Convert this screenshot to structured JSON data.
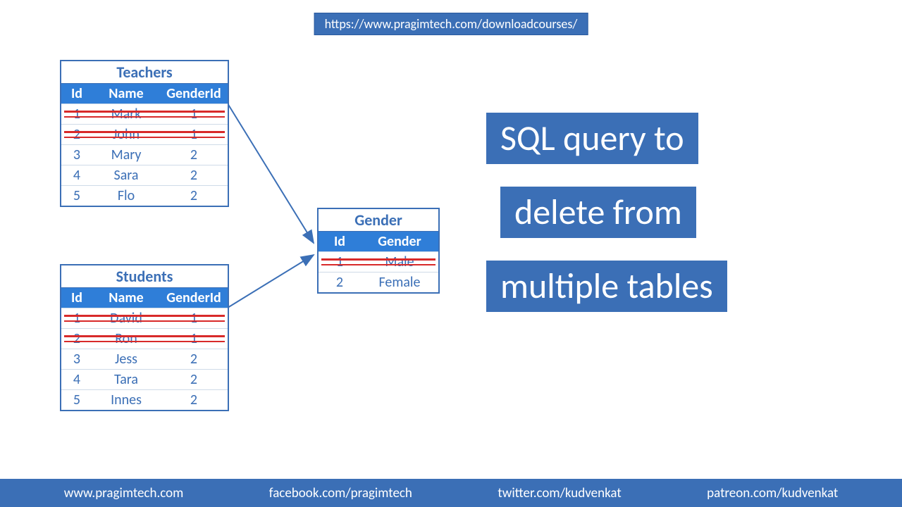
{
  "top_url": "https://www.pragimtech.com/downloadcourses/",
  "tables": {
    "teachers": {
      "title": "Teachers",
      "cols": [
        "Id",
        "Name",
        "GenderId"
      ],
      "rows": [
        {
          "c": [
            "1",
            "Mark",
            "1"
          ],
          "deleted": true
        },
        {
          "c": [
            "2",
            "John",
            "1"
          ],
          "deleted": true
        },
        {
          "c": [
            "3",
            "Mary",
            "2"
          ],
          "deleted": false
        },
        {
          "c": [
            "4",
            "Sara",
            "2"
          ],
          "deleted": false
        },
        {
          "c": [
            "5",
            "Flo",
            "2"
          ],
          "deleted": false
        }
      ]
    },
    "students": {
      "title": "Students",
      "cols": [
        "Id",
        "Name",
        "GenderId"
      ],
      "rows": [
        {
          "c": [
            "1",
            "David",
            "1"
          ],
          "deleted": true
        },
        {
          "c": [
            "2",
            "Ron",
            "1"
          ],
          "deleted": true
        },
        {
          "c": [
            "3",
            "Jess",
            "2"
          ],
          "deleted": false
        },
        {
          "c": [
            "4",
            "Tara",
            "2"
          ],
          "deleted": false
        },
        {
          "c": [
            "5",
            "Innes",
            "2"
          ],
          "deleted": false
        }
      ]
    },
    "gender": {
      "title": "Gender",
      "cols": [
        "Id",
        "Gender"
      ],
      "rows": [
        {
          "c": [
            "1",
            "Male"
          ],
          "deleted": true
        },
        {
          "c": [
            "2",
            "Female"
          ],
          "deleted": false
        }
      ]
    }
  },
  "headline": {
    "line1": "SQL query to",
    "line2": "delete from",
    "line3": "multiple tables"
  },
  "footer": {
    "site": "www.pragimtech.com",
    "facebook": "facebook.com/pragimtech",
    "twitter": "twitter.com/kudvenkat",
    "patreon": "patreon.com/kudvenkat"
  },
  "colors": {
    "brand": "#3b6fb6",
    "header": "#2f7ed8",
    "strike": "#d82a2a"
  }
}
